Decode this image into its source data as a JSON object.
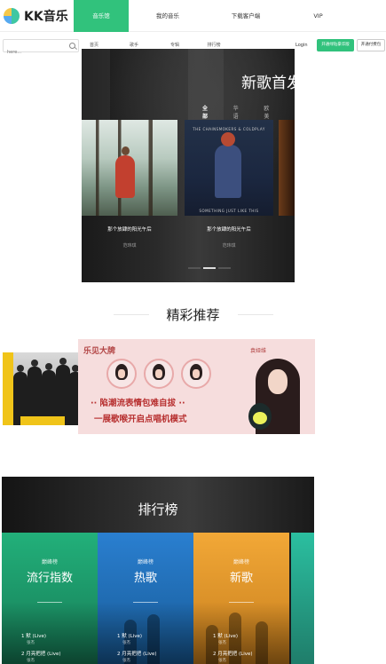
{
  "header": {
    "logo_text": "KK音乐",
    "nav": [
      {
        "label": "音乐馆",
        "active": true
      },
      {
        "label": "我的音乐",
        "active": false
      },
      {
        "label": "下载客户端",
        "active": false
      },
      {
        "label": "VIP",
        "active": false
      }
    ]
  },
  "subbar": {
    "search_placeholder": "here...",
    "subnav": [
      "首页",
      "歌手",
      "专辑",
      "排行榜"
    ],
    "login_label": "Login",
    "green_button_label": "开通绿钻豪华版",
    "white_button_label": "开通付费包"
  },
  "new_songs": {
    "title": "新歌首发",
    "tabs": [
      {
        "label": "全部",
        "active": true
      },
      {
        "label": "华语",
        "active": false
      },
      {
        "label": "欧美",
        "active": false
      }
    ],
    "albums": [
      {
        "title": "那个放肆的阳光午后",
        "artist": "范玮琪"
      },
      {
        "title": "那个放肆的阳光午后",
        "artist": "范玮琪",
        "cover_band": "THE CHAINSMOKERS & COLDPLAY",
        "cover_song": "SOMETHING JUST LIKE THIS"
      }
    ]
  },
  "featured": {
    "title": "精彩推荐",
    "banner": {
      "tag": "乐见大牌",
      "name": "袁娅维",
      "line1": "·· 陷潮流表情包难自拔 ··",
      "line2": "一展歌喉开启点唱机模式"
    }
  },
  "ranking": {
    "title": "排行榜",
    "cards": [
      {
        "small": "巅峰榜",
        "big": "流行指数",
        "color": "#1fa36f",
        "songs": [
          {
            "song": "1 默 (Live)",
            "artist": "张杰"
          },
          {
            "song": "2 月亮把把 (Live)",
            "artist": "张杰"
          }
        ]
      },
      {
        "small": "巅峰榜",
        "big": "热歌",
        "color": "#1f6fb8",
        "songs": [
          {
            "song": "1 默 (Live)",
            "artist": "张杰"
          },
          {
            "song": "2 月亮把把 (Live)",
            "artist": "张杰"
          }
        ]
      },
      {
        "small": "巅峰榜",
        "big": "新歌",
        "color": "#eb9a2c",
        "songs": [
          {
            "song": "1 默 (Live)",
            "artist": "张杰"
          },
          {
            "song": "2 月亮把把 (Live)",
            "artist": "张杰"
          }
        ]
      }
    ]
  }
}
